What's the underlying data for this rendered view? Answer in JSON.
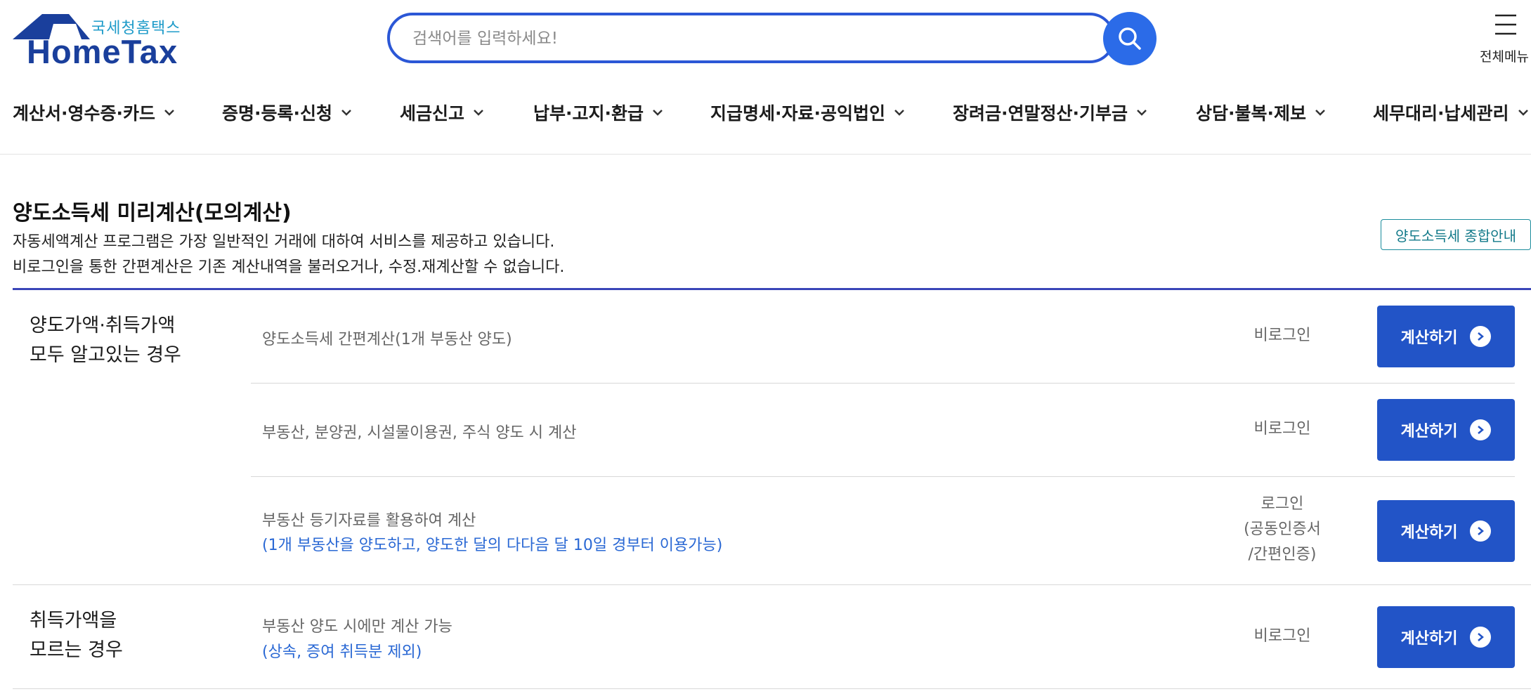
{
  "header": {
    "logo_sub": "국세청홈택스",
    "logo_main": "HomeTax",
    "search_placeholder": "검색어를 입력하세요!",
    "menu_label": "전체메뉴"
  },
  "gnb": [
    {
      "label": "계산서·영수증·카드"
    },
    {
      "label": "증명·등록·신청"
    },
    {
      "label": "세금신고"
    },
    {
      "label": "납부·고지·환급"
    },
    {
      "label": "지급명세·자료·공익법인"
    },
    {
      "label": "장려금·연말정산·기부금"
    },
    {
      "label": "상담·불복·제보"
    },
    {
      "label": "세무대리·납세관리"
    }
  ],
  "page": {
    "title": "양도소득세 미리계산(모의계산)",
    "desc1": "자동세액계산 프로그램은 가장 일반적인 거래에 대하여 서비스를 제공하고 있습니다.",
    "desc2": "비로그인을 통한 간편계산은 기존 계산내역을 불러오거나, 수정.재계산할 수 없습니다.",
    "guide_button": "양도소득세 종합안내"
  },
  "groups": [
    {
      "line1": "양도가액·취득가액",
      "line2": "모두 알고있는 경우"
    },
    {
      "line1": "취득가액을",
      "line2": "모르는 경우"
    }
  ],
  "rows": [
    {
      "desc": "양도소득세 간편계산(1개 부동산 양도)",
      "note": "",
      "status": "비로그인",
      "button": "계산하기"
    },
    {
      "desc": "부동산, 분양권, 시설물이용권, 주식 양도 시 계산",
      "note": "",
      "status": "비로그인",
      "button": "계산하기"
    },
    {
      "desc": "부동산 등기자료를 활용하여 계산",
      "note": "(1개 부동산을 양도하고, 양도한 달의 다다음 달 10일 경부터 이용가능)",
      "status": "로그인",
      "status2": "(공동인증서",
      "status3": "/간편인증)",
      "button": "계산하기"
    },
    {
      "desc": "부동산 양도 시에만 계산 가능",
      "note": "(상속, 증여 취득분 제외)",
      "status": "비로그인",
      "button": "계산하기"
    }
  ],
  "colors": {
    "brand": "#1a3f9c",
    "accent": "#2b57d6",
    "button": "#2254c7",
    "note": "#2a68d4",
    "table_top": "#3b46b8"
  }
}
